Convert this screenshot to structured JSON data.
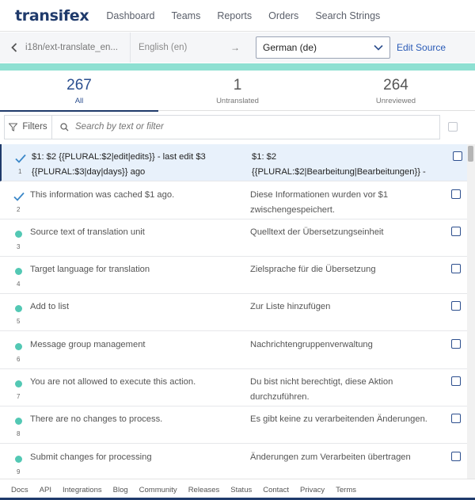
{
  "brand": {
    "logo": "transifex"
  },
  "nav": [
    "Dashboard",
    "Teams",
    "Reports",
    "Orders",
    "Search Strings"
  ],
  "subbar": {
    "path": "i18n/ext-translate_en...",
    "source_lang": "English (en)",
    "arrow": "→",
    "target_lang": "German (de)",
    "edit_source": "Edit Source"
  },
  "tabs": [
    {
      "count": "267",
      "label": "All"
    },
    {
      "count": "1",
      "label": "Untranslated"
    },
    {
      "count": "264",
      "label": "Unreviewed"
    }
  ],
  "filter": {
    "label": "Filters",
    "placeholder": "Search by text or filter"
  },
  "rows": [
    {
      "n": "1",
      "status": "check",
      "source": "$1: $2 {{PLURAL:$2|edit|edits}} - last edit $3 {{PLURAL:$3|day|days}} ago",
      "target": "$1: $2 {{PLURAL:$2|Bearbeitung|Bearbeitungen}} -"
    },
    {
      "n": "2",
      "status": "check",
      "source": "This information was cached $1 ago.",
      "target": "Diese Informationen wurden vor $1 zwischengespeichert."
    },
    {
      "n": "3",
      "status": "dot",
      "source": "Source text of translation unit",
      "target": "Quelltext der Übersetzungseinheit"
    },
    {
      "n": "4",
      "status": "dot",
      "source": "Target language for translation",
      "target": "Zielsprache für die Übersetzung"
    },
    {
      "n": "5",
      "status": "dot",
      "source": "Add to list",
      "target": "Zur Liste hinzufügen"
    },
    {
      "n": "6",
      "status": "dot",
      "source": "Message group management",
      "target": "Nachrichtengruppenverwaltung"
    },
    {
      "n": "7",
      "status": "dot",
      "source": "You are not allowed to execute this action.",
      "target": "Du bist nicht berechtigt, diese Aktion durchzuführen."
    },
    {
      "n": "8",
      "status": "dot",
      "source": "There are no changes to process.",
      "target": "Es gibt keine zu verarbeitenden Änderungen."
    },
    {
      "n": "9",
      "status": "dot",
      "source": "Submit changes for processing",
      "target": "Änderungen zum Verarbeiten übertragen"
    }
  ],
  "footer": [
    "Docs",
    "API",
    "Integrations",
    "Blog",
    "Community",
    "Releases",
    "Status",
    "Contact",
    "Privacy",
    "Terms"
  ],
  "colors": {
    "accent": "#1f3a6b",
    "teal": "#53c8b4",
    "link": "#2a5bb7"
  }
}
